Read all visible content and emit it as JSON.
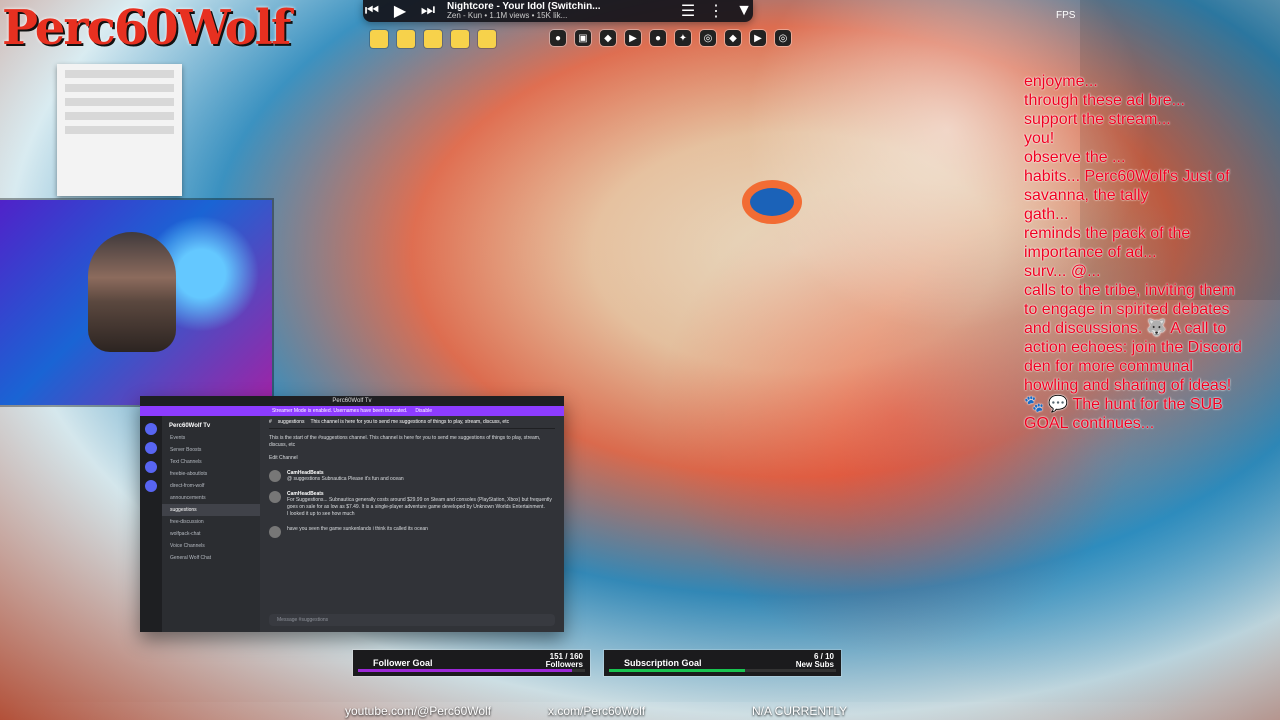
{
  "desktop": {
    "logo_text": "Perc60Wolf",
    "fps_label": "FPS"
  },
  "media_player": {
    "title": "Nightcore - Your Idol (Switchin...",
    "subtitle": "Zen - Kun • 1.1M views • 15K lik..."
  },
  "discord": {
    "window_title": "Perc60Wolf Tv",
    "notice": "Streamer Mode is enabled. Usernames have been truncated.",
    "notice_button": "Disable",
    "server": "Perc60Wolf Tv",
    "sidebar_items": [
      "Events",
      "Server Boosts",
      "Text Channels",
      "freebie-aboutlots",
      "direct-from-wolf",
      "announcements",
      "suggestions",
      "free-discussion",
      "wolfpack-chat",
      "Voice Channels",
      "General Wolf Chat"
    ],
    "current_channel": "suggestions",
    "topic": "This channel is here for you to send me suggestions of things to play, stream, discuss, etc",
    "search_placeholder": "Search Perc60Wolf Tv",
    "intro": "This is the start of the #suggestions channel. This channel is here for you to send me suggestions of things to play, stream, discuss, etc",
    "edit_channel": "Edit Channel",
    "dates": [
      "October 23, 2024",
      "October 26, 2024",
      "November 19, 2024"
    ],
    "messages": [
      {
        "name": "CamHeadBeats",
        "time": "10/23/2024 12:26 AM",
        "body": "@ suggestions Subnautica Please it's fun and ocean"
      },
      {
        "name": "CamHeadBeats",
        "time": "10/26/2024 1:59 PM",
        "body": "For Suggestions... Subnautica generally costs around $29.99 on Steam and consoles (PlayStation, Xbox) but frequently goes on sale for as low as $7.49. It is a single-player adventure game developed by Unknown Worlds Entertainment."
      },
      {
        "name": "",
        "time": "",
        "body": "I looked it up to see how much"
      },
      {
        "name": "",
        "time": "11/19/2024 4:29 PM",
        "body": "have you seen the game sunkenlands i think its called its ocean"
      }
    ],
    "input_placeholder": "Message #suggestions"
  },
  "chat_overlay": {
    "lines": [
      "enjoyme...",
      "through these ad bre...",
      "support the stream...",
      "you!",
      "observe the ...",
      "habits... Perc60Wolf's Just of",
      "savanna, the tally",
      "gath...",
      "reminds the pack of the",
      "importance of ad...",
      "surv... @...",
      "calls to the tribe, inviting them",
      "to engage in spirited debates",
      "and discussions. 🐺 A call to",
      "action echoes: join the Discord",
      "den for more communal",
      "howling and sharing of ideas!",
      "🐾 💬 The hunt for the SUB",
      "GOAL continues..."
    ]
  },
  "goals": {
    "follower_label": "Follower Goal",
    "follower_count": "151 / 160",
    "follower_unit": "Followers",
    "follower_progress": 0.944,
    "sub_label": "Subscription Goal",
    "sub_count": "6 / 10",
    "sub_unit": "New Subs",
    "sub_progress": 0.6
  },
  "social": {
    "youtube": "youtube.com/@Perc60Wolf",
    "x": "x.com/Perc60Wolf",
    "facebook": "N/A CURRENTLY"
  }
}
